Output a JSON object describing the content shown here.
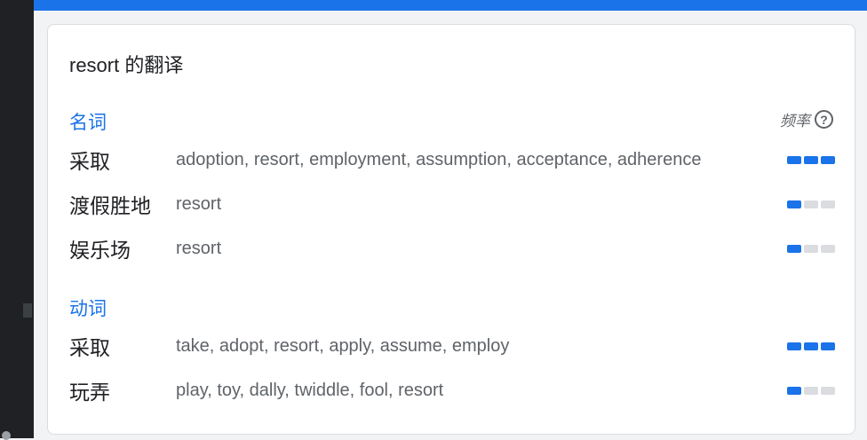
{
  "card": {
    "title": "resort 的翻译",
    "frequency_label": "频率",
    "help_icon": "question-circle-icon"
  },
  "sections": [
    {
      "pos": "名词",
      "rows": [
        {
          "term": "采取",
          "synonyms": "adoption, resort, employment, assumption, acceptance, adherence",
          "frequency": 3
        },
        {
          "term": "渡假胜地",
          "synonyms": "resort",
          "frequency": 1
        },
        {
          "term": "娱乐场",
          "synonyms": "resort",
          "frequency": 1
        }
      ]
    },
    {
      "pos": "动词",
      "rows": [
        {
          "term": "采取",
          "synonyms": "take, adopt, resort, apply, assume, employ",
          "frequency": 3
        },
        {
          "term": "玩弄",
          "synonyms": "play, toy, dally, twiddle, fool, resort",
          "frequency": 1
        }
      ]
    }
  ],
  "colors": {
    "accent": "#1a73e8",
    "inactive": "#dadce0"
  }
}
